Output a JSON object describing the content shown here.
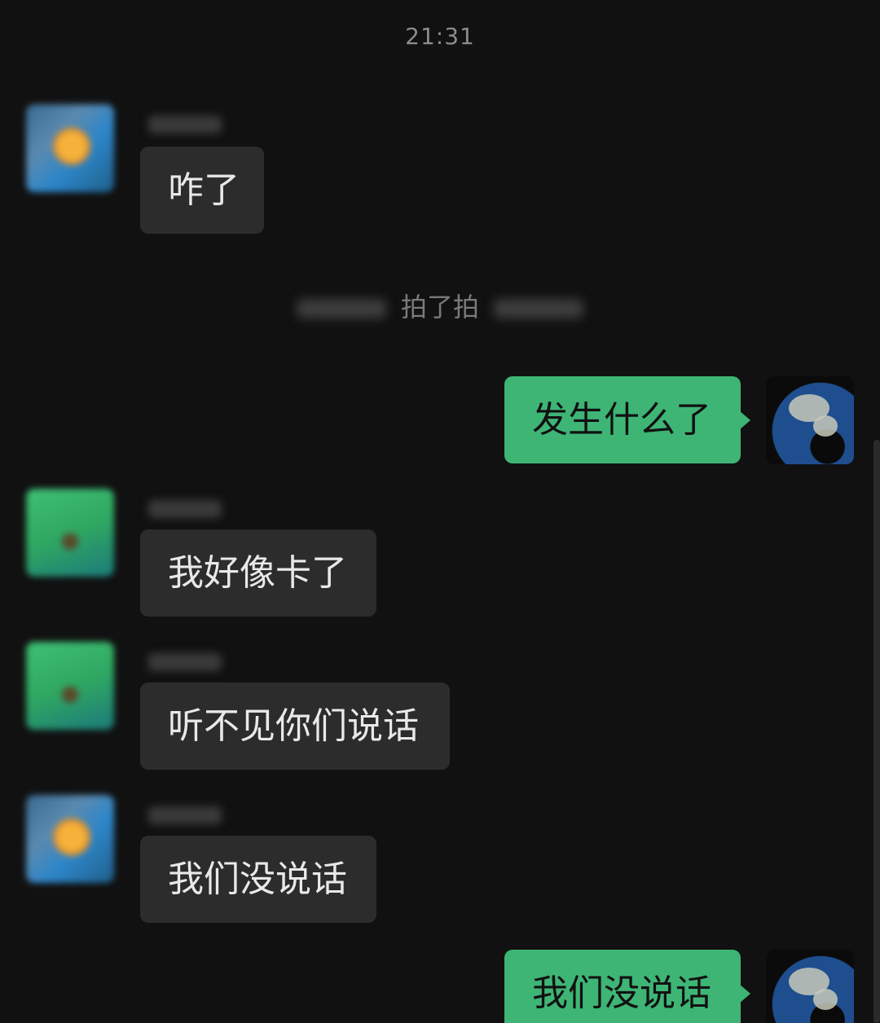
{
  "status": {
    "time": "21:31"
  },
  "system_message": {
    "action_text": "拍了拍"
  },
  "messages": [
    {
      "text": "咋了"
    },
    {
      "text": "发生什么了"
    },
    {
      "text": "我好像卡了"
    },
    {
      "text": "听不见你们说话"
    },
    {
      "text": "我们没说话"
    },
    {
      "text": "我们没说话"
    }
  ]
}
